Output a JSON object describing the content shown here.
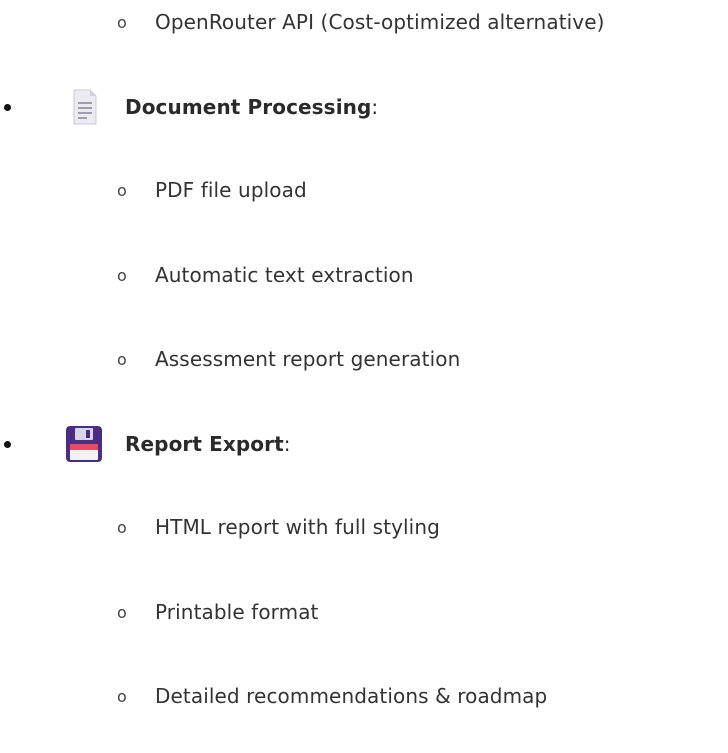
{
  "items": [
    {
      "type": "sub",
      "marker": "o",
      "text": "OpenRouter API (Cost-optimized alternative)"
    },
    {
      "type": "main",
      "icon": "document-icon",
      "label": "Document Processing",
      "suffix": ":"
    },
    {
      "type": "sub",
      "marker": "o",
      "text": "PDF file upload"
    },
    {
      "type": "sub",
      "marker": "o",
      "text": "Automatic text extraction"
    },
    {
      "type": "sub",
      "marker": "o",
      "text": "Assessment report generation"
    },
    {
      "type": "main",
      "icon": "floppy-disk-icon",
      "label": "Report Export",
      "suffix": ":"
    },
    {
      "type": "sub",
      "marker": "o",
      "text": "HTML report with full styling"
    },
    {
      "type": "sub",
      "marker": "o",
      "text": "Printable format"
    },
    {
      "type": "sub",
      "marker": "o",
      "text": "Detailed recommendations & roadmap"
    }
  ],
  "colors": {
    "text": "#333333",
    "bullet": "#111111",
    "document_icon_body": "#ecebf2",
    "document_icon_lines": "#9e9caf",
    "floppy_body": "#4b2e83",
    "floppy_label": "#e84a5f",
    "floppy_window": "#f2f2f2"
  }
}
